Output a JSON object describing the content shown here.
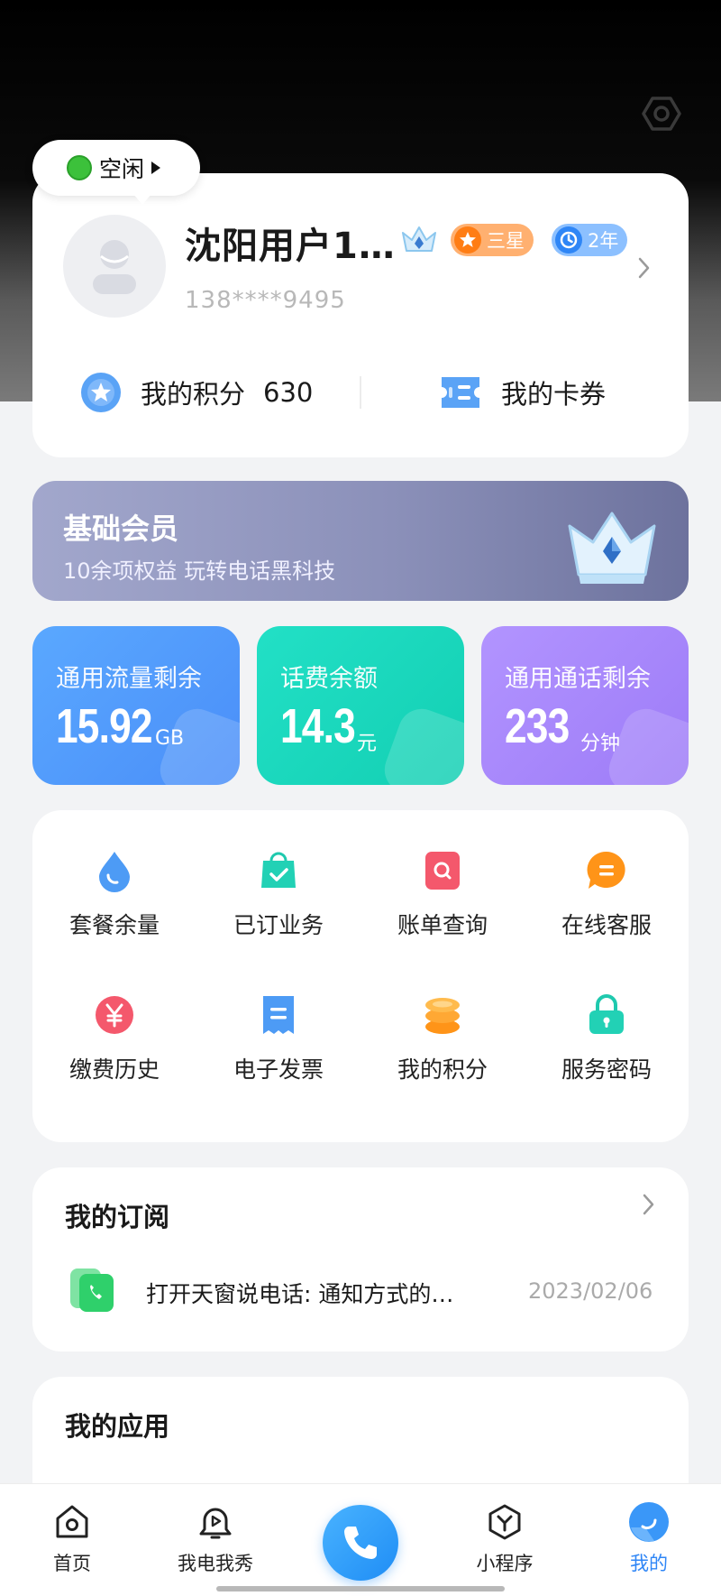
{
  "status": {
    "label": "空闲"
  },
  "profile": {
    "name": "沈阳用户1…",
    "phone": "138****9495",
    "star_badge": "三星",
    "years_badge": "2年"
  },
  "points": {
    "label": "我的积分",
    "value": "630"
  },
  "coupons": {
    "label": "我的卡券"
  },
  "membership": {
    "title": "基础会员",
    "subtitle": "10余项权益 玩转电话黑科技"
  },
  "stats": [
    {
      "label": "通用流量剩余",
      "value": "15.92",
      "unit": "GB"
    },
    {
      "label": "话费余额",
      "value": "14.3",
      "unit": "元"
    },
    {
      "label": "通用通话剩余",
      "value": "233",
      "unit": "分钟"
    }
  ],
  "services": [
    {
      "label": "套餐余量",
      "icon": "drop-icon"
    },
    {
      "label": "已订业务",
      "icon": "bag-check-icon"
    },
    {
      "label": "账单查询",
      "icon": "bill-search-icon"
    },
    {
      "label": "在线客服",
      "icon": "chat-icon"
    },
    {
      "label": "缴费历史",
      "icon": "yuan-icon"
    },
    {
      "label": "电子发票",
      "icon": "invoice-icon"
    },
    {
      "label": "我的积分",
      "icon": "coins-icon"
    },
    {
      "label": "服务密码",
      "icon": "lock-icon"
    }
  ],
  "subscriptions": {
    "title": "我的订阅",
    "items": [
      {
        "text": "打开天窗说电话: 通知方式的…",
        "date": "2023/02/06"
      }
    ]
  },
  "apps": {
    "title": "我的应用"
  },
  "tabbar": [
    {
      "label": "首页",
      "icon": "home-icon"
    },
    {
      "label": "我电我秀",
      "icon": "bell-play-icon"
    },
    {
      "label": "小程序",
      "icon": "mini-program-icon"
    },
    {
      "label": "我的",
      "icon": "me-icon"
    }
  ],
  "colors": {
    "accent": "#2f86f6",
    "flow_card": "#5aa8ff",
    "fee_card": "#1ed6bb",
    "call_card": "#a888fb"
  }
}
